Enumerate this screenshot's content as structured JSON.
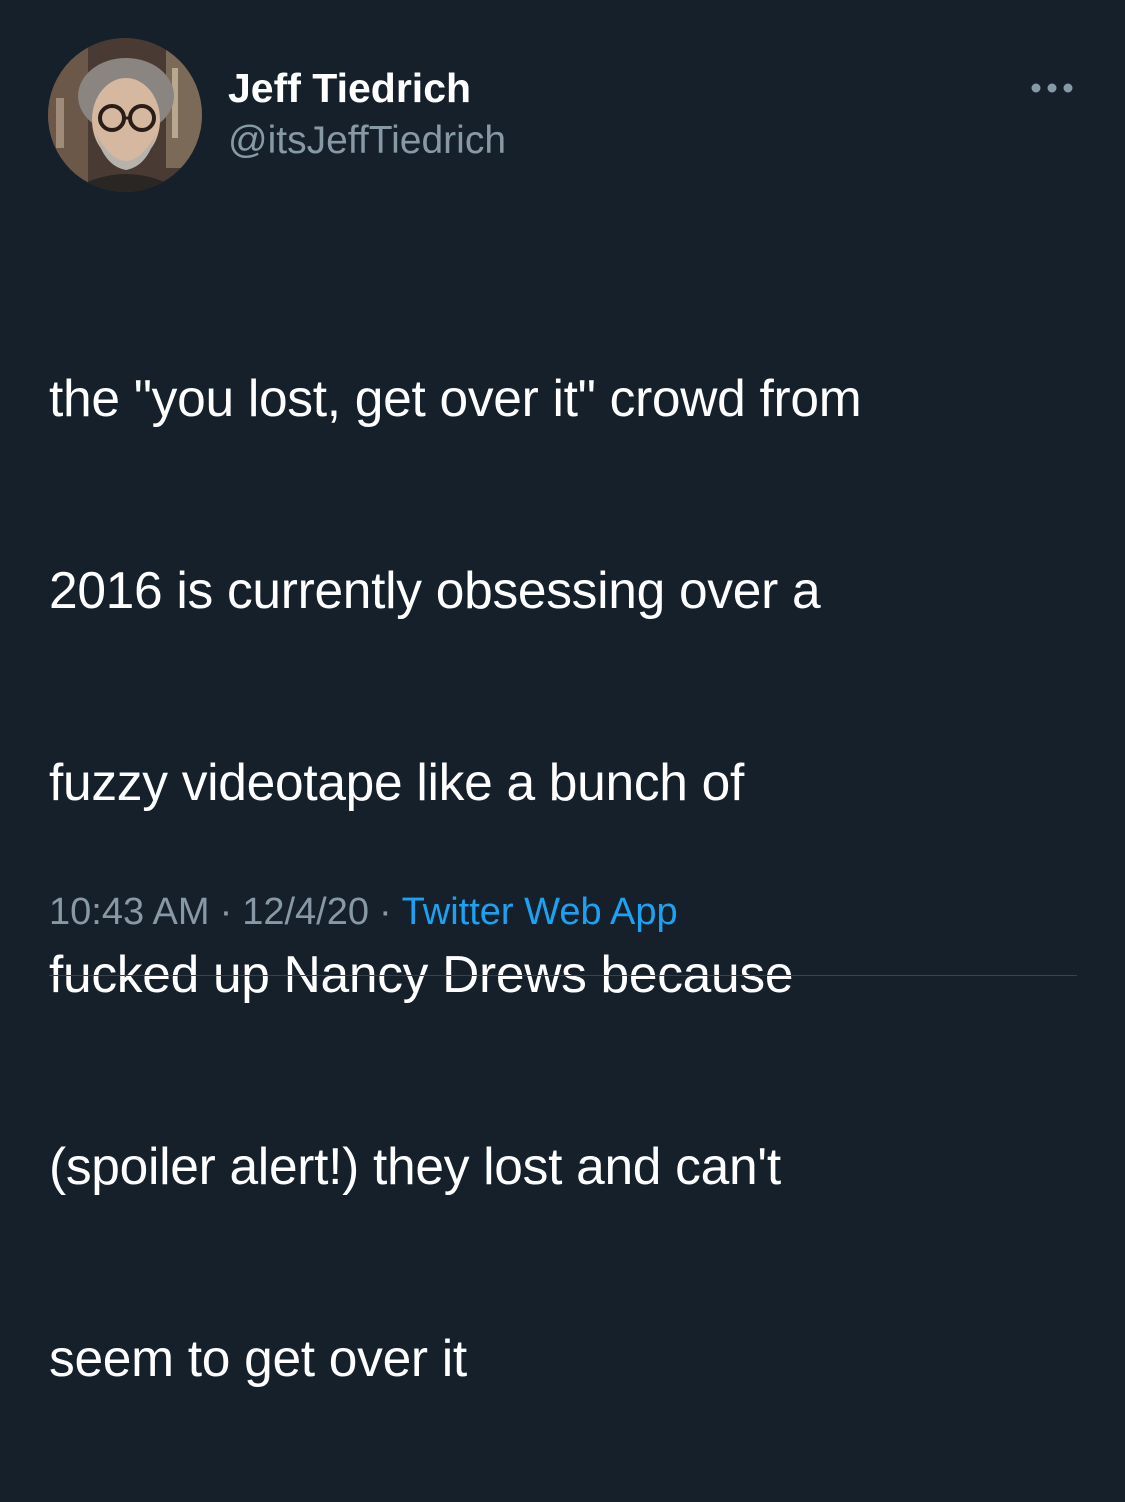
{
  "author": {
    "name": "Jeff Tiedrich",
    "handle": "@itsJeffTiedrich"
  },
  "tweet": {
    "lines": [
      "the \"you lost, get over it\" crowd from",
      "2016 is currently obsessing over a",
      "fuzzy videotape like a bunch of",
      "fucked up Nancy Drews because",
      "(spoiler alert!) they lost and can't",
      "seem to get over it"
    ]
  },
  "meta": {
    "time": "10:43 AM",
    "separator": "·",
    "date": "12/4/20",
    "source": "Twitter Web App"
  },
  "icons": {
    "more": "more-horizontal-icon"
  },
  "colors": {
    "background": "#15202b",
    "secondary_text": "#8899a6",
    "link": "#1da1f2"
  }
}
